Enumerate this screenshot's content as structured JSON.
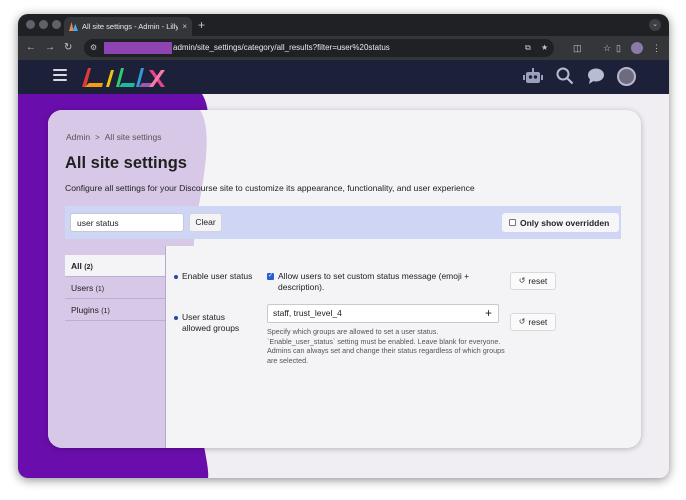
{
  "browser": {
    "tab_title": "All site settings - Admin - Lilly",
    "tab_close": "×",
    "new_tab": "+",
    "url": "admin/site_settings/category/all_results?filter=user%20status"
  },
  "header": {
    "logo_text": "LILLY"
  },
  "breadcrumb": {
    "root": "Admin",
    "separator": ">",
    "current": "All site settings"
  },
  "page": {
    "title": "All site settings",
    "subtitle": "Configure all settings for your Discourse site to customize its appearance, functionality, and user experience"
  },
  "filter": {
    "value": "user status",
    "clear_label": "Clear",
    "only_overridden_label": "Only show overridden"
  },
  "nav": {
    "items": [
      {
        "label": "All",
        "count": "(2)",
        "active": true
      },
      {
        "label": "Users",
        "count": "(1)",
        "active": false
      },
      {
        "label": "Plugins",
        "count": "(1)",
        "active": false
      }
    ]
  },
  "settings": [
    {
      "name": "Enable user status",
      "checkbox_label": "Allow users to set custom status message (emoji + description).",
      "checked": true,
      "reset_label": "reset"
    },
    {
      "name_line1": "User status",
      "name_line2": "allowed groups",
      "value": "staff, trust_level_4",
      "help": "Specify which groups are allowed to set a user status. `Enable_user_status` setting must be enabled. Leave blank for everyone. Admins can always set and change their status regardless of which groups are selected.",
      "reset_label": "reset"
    }
  ],
  "colors": {
    "header_bg": "#1c2038",
    "sidebar_purple": "#6a0dad",
    "accent_blue": "#2547a8"
  }
}
